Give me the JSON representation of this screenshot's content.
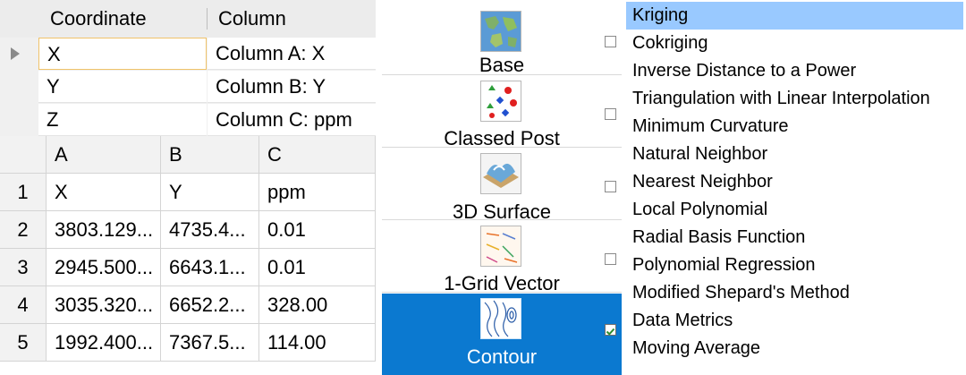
{
  "coordinate_grid": {
    "headers": [
      "Coordinate",
      "Column"
    ],
    "rows": [
      {
        "coordinate": "X",
        "column": "Column A:  X"
      },
      {
        "coordinate": "Y",
        "column": "Column B:  Y"
      },
      {
        "coordinate": "Z",
        "column": "Column C:  ppm"
      }
    ]
  },
  "worksheet": {
    "column_headers": [
      "A",
      "B",
      "C"
    ],
    "rows": [
      {
        "num": "1",
        "a": "X",
        "b": "Y",
        "c": "ppm"
      },
      {
        "num": "2",
        "a": "3803.129...",
        "b": "4735.4...",
        "c": "0.01"
      },
      {
        "num": "3",
        "a": "2945.500...",
        "b": "6643.1...",
        "c": "0.01"
      },
      {
        "num": "4",
        "a": "3035.320...",
        "b": "6652.2...",
        "c": "328.00"
      },
      {
        "num": "5",
        "a": "1992.400...",
        "b": "7367.5...",
        "c": "114.00"
      }
    ]
  },
  "map_types": [
    {
      "label": "Base",
      "icon": "globe-map-icon",
      "checked": false
    },
    {
      "label": "Classed Post",
      "icon": "classed-post-icon",
      "checked": false
    },
    {
      "label": "3D Surface",
      "icon": "surface-3d-icon",
      "checked": false
    },
    {
      "label": "1-Grid Vector",
      "icon": "vector-arrows-icon",
      "checked": false
    },
    {
      "label": "Contour",
      "icon": "contour-lines-icon",
      "checked": true
    }
  ],
  "gridding_methods": [
    "Kriging",
    "Cokriging",
    "Inverse Distance to a Power",
    "Triangulation with Linear Interpolation",
    "Minimum Curvature",
    "Natural Neighbor",
    "Nearest Neighbor",
    "Local Polynomial",
    "Radial Basis Function",
    "Polynomial Regression",
    "Modified Shepard's Method",
    "Data Metrics",
    "Moving Average"
  ],
  "selected_method": "Kriging",
  "colors": {
    "selection_blue": "#0b79d0",
    "method_highlight": "#99c9ff",
    "cell_focus_border": "#f0c36a"
  }
}
